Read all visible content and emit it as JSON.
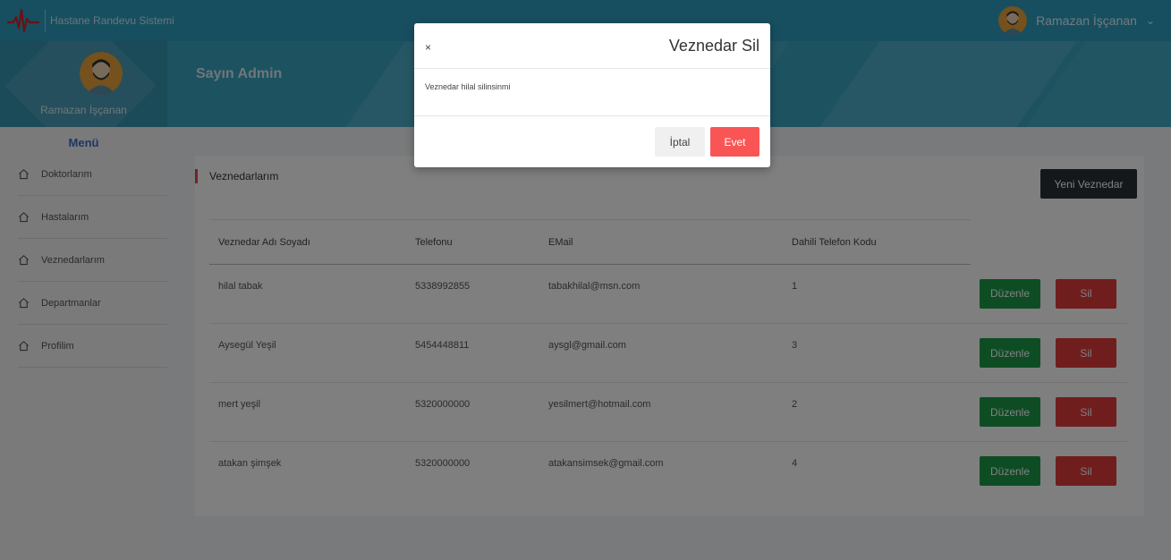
{
  "app": {
    "name": "Hastane Randevu Sistemi"
  },
  "user": {
    "name": "Ramazan İşçanan"
  },
  "header": {
    "greeting": "Sayın Admin"
  },
  "sidebar": {
    "title": "Menü",
    "items": [
      {
        "label": "Doktorlarım",
        "icon": "home-icon"
      },
      {
        "label": "Hastalarım",
        "icon": "home-icon"
      },
      {
        "label": "Veznedarlarım",
        "icon": "home-icon"
      },
      {
        "label": "Departmanlar",
        "icon": "home-icon"
      },
      {
        "label": "Profilim",
        "icon": "home-icon"
      }
    ]
  },
  "panel": {
    "title": "Veznedarlarım",
    "new_button": "Yeni Veznedar",
    "columns": [
      "Veznedar Adı Soyadı",
      "Telefonu",
      "EMail",
      "Dahili Telefon Kodu"
    ],
    "rows": [
      {
        "name": "hilal tabak",
        "phone": "5338992855",
        "email": "tabakhilal@msn.com",
        "ext": "1"
      },
      {
        "name": "Aysegül Yeşil",
        "phone": "5454448811",
        "email": "aysgl@gmail.com",
        "ext": "3"
      },
      {
        "name": "mert yeşil",
        "phone": "5320000000",
        "email": "yesilmert@hotmail.com",
        "ext": "2"
      },
      {
        "name": "atakan şimşek",
        "phone": "5320000000",
        "email": "atakansimsek@gmail.com",
        "ext": "4"
      }
    ],
    "edit_label": "Düzenle",
    "delete_label": "Sil"
  },
  "modal": {
    "close": "×",
    "title": "Veznedar Sil",
    "body": "Veznedar hilal silinsinmi",
    "cancel": "İptal",
    "confirm": "Evet"
  },
  "colors": {
    "topbar": "#2e9fc0",
    "edit": "#1c9a48",
    "delete": "#e03a3c",
    "confirm": "#fa5555"
  }
}
